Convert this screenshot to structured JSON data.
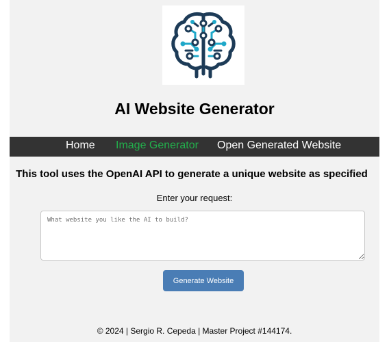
{
  "header": {
    "logo_icon": "ai-brain-circuit-logo-icon",
    "title": "AI Website Generator"
  },
  "nav": {
    "items": [
      {
        "label": "Home",
        "color": "#ffffff"
      },
      {
        "label": "Image Generator",
        "color": "#22b14c"
      },
      {
        "label": "Open Generated Website",
        "color": "#ffffff"
      }
    ],
    "background": "#333333"
  },
  "main": {
    "intro": "This tool uses the OpenAI API to generate a unique website as specified",
    "request_label": "Enter your request:",
    "request_placeholder": "What website you like the AI to build?",
    "request_value": "",
    "generate_label": "Generate Website",
    "accent": "#4a7db5"
  },
  "footer": {
    "text": "© 2024 | Sergio R. Cepeda | Master Project #144174."
  }
}
